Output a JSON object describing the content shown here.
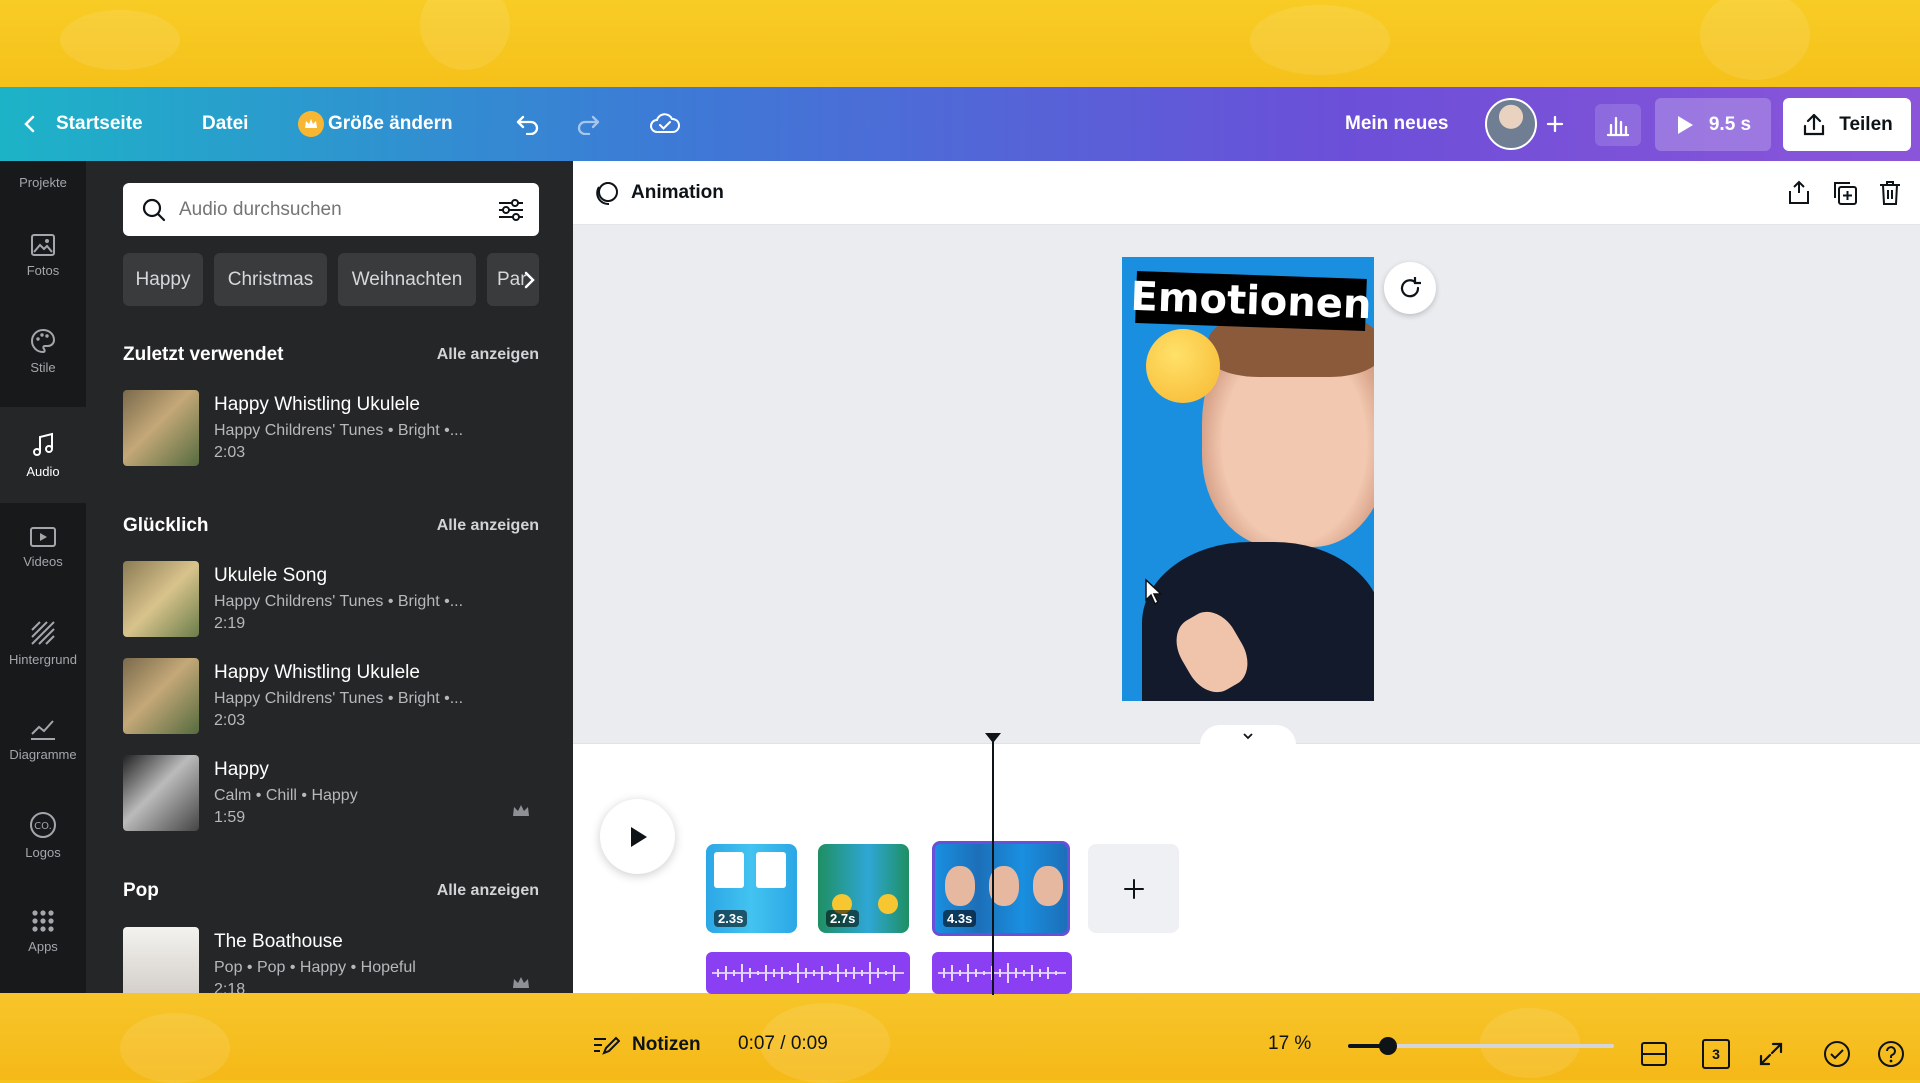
{
  "header": {
    "back_label": "Startseite",
    "file_label": "Datei",
    "resize_label": "Größe ändern",
    "project_title": "Mein neues",
    "play_duration": "9.5 s",
    "share_label": "Teilen"
  },
  "rail": {
    "items": [
      {
        "label": "Projekte",
        "icon": "folder-icon"
      },
      {
        "label": "Fotos",
        "icon": "photo-icon"
      },
      {
        "label": "Stile",
        "icon": "palette-icon"
      },
      {
        "label": "Audio",
        "icon": "music-note-icon"
      },
      {
        "label": "Videos",
        "icon": "video-icon"
      },
      {
        "label": "Hintergrund",
        "icon": "background-icon"
      },
      {
        "label": "Diagramme",
        "icon": "chart-icon"
      },
      {
        "label": "Logos",
        "icon": "logo-icon"
      },
      {
        "label": "Apps",
        "icon": "apps-grid-icon"
      }
    ],
    "active": "Audio"
  },
  "panel": {
    "search_placeholder": "Audio durchsuchen",
    "chips": [
      "Happy",
      "Christmas",
      "Weihnachten",
      "Par"
    ],
    "sections": [
      {
        "title": "Zuletzt verwendet",
        "see_all": "Alle anzeigen",
        "tracks": [
          {
            "title": "Happy Whistling Ukulele",
            "meta": "Happy Childrens' Tunes • Bright •...",
            "duration": "2:03",
            "premium": false
          }
        ]
      },
      {
        "title": "Glücklich",
        "see_all": "Alle anzeigen",
        "tracks": [
          {
            "title": "Ukulele Song",
            "meta": "Happy Childrens' Tunes • Bright •...",
            "duration": "2:19",
            "premium": false
          },
          {
            "title": "Happy Whistling Ukulele",
            "meta": "Happy Childrens' Tunes • Bright •...",
            "duration": "2:03",
            "premium": false
          },
          {
            "title": "Happy",
            "meta": "Calm • Chill • Happy",
            "duration": "1:59",
            "premium": true
          }
        ]
      },
      {
        "title": "Pop",
        "see_all": "Alle anzeigen",
        "tracks": [
          {
            "title": "The Boathouse",
            "meta": "Pop • Pop • Happy • Hopeful",
            "duration": "2:18",
            "premium": true
          }
        ]
      }
    ]
  },
  "toolbar": {
    "animation_label": "Animation"
  },
  "canvas": {
    "overlay_text": "Emotionen"
  },
  "timeline": {
    "scenes": [
      {
        "duration": "2.3s"
      },
      {
        "duration": "2.7s"
      },
      {
        "duration": "4.3s"
      }
    ],
    "selected_scene": 3
  },
  "footer": {
    "notes_label": "Notizen",
    "time": "0:07 / 0:09",
    "zoom": "17 %",
    "zoom_level_fraction": 0.15,
    "page_count": "3"
  },
  "colors": {
    "accent_purple": "#8b3ff3",
    "rail_bg": "#18191b",
    "panel_bg": "#252627",
    "canvas_blue": "#1a8fe0"
  }
}
